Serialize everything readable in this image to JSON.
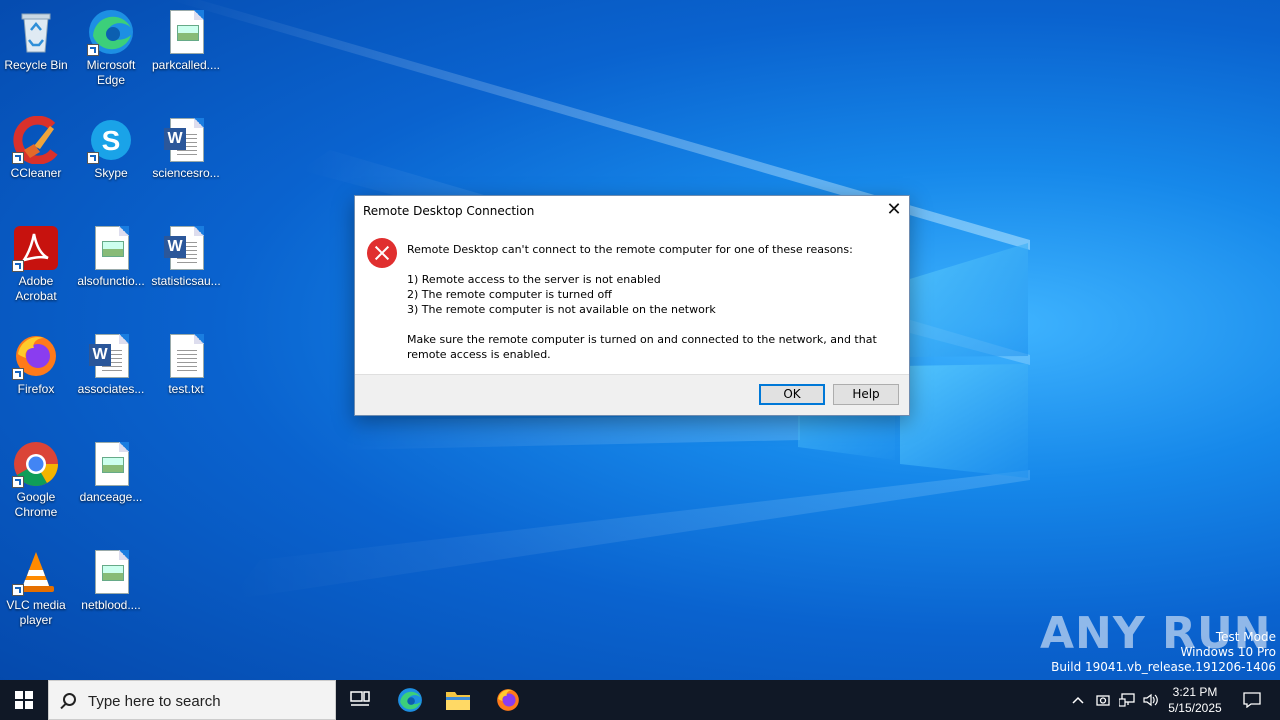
{
  "desktop": {
    "icons": [
      {
        "label": "Recycle Bin"
      },
      {
        "label": "Microsoft Edge"
      },
      {
        "label": "parkcalled...."
      },
      {
        "label": "CCleaner"
      },
      {
        "label": "Skype"
      },
      {
        "label": "sciencesro..."
      },
      {
        "label": "Adobe Acrobat"
      },
      {
        "label": "alsofunctio..."
      },
      {
        "label": "statisticsau..."
      },
      {
        "label": "Firefox"
      },
      {
        "label": "associates..."
      },
      {
        "label": "test.txt"
      },
      {
        "label": "Google Chrome"
      },
      {
        "label": "danceage..."
      },
      {
        "label": "VLC media player"
      },
      {
        "label": "netblood...."
      }
    ]
  },
  "dialog": {
    "title": "Remote Desktop Connection",
    "close_glyph": "✕",
    "heading": "Remote Desktop can't connect to the remote computer for one of these reasons:",
    "reasons": [
      "1) Remote access to the server is not enabled",
      "2) The remote computer is turned off",
      "3) The remote computer is not available on the network"
    ],
    "advice": "Make sure the remote computer is turned on and connected to the network, and that remote access is enabled.",
    "ok_label": "OK",
    "help_label": "Help"
  },
  "watermark": {
    "brand": "ANY RUN",
    "line1": "Test Mode",
    "line2": "Windows 10 Pro",
    "line3": "Build 19041.vb_release.191206-1406"
  },
  "taskbar": {
    "search_placeholder": "Type here to search",
    "time": "3:21 PM",
    "date": "5/15/2025"
  }
}
